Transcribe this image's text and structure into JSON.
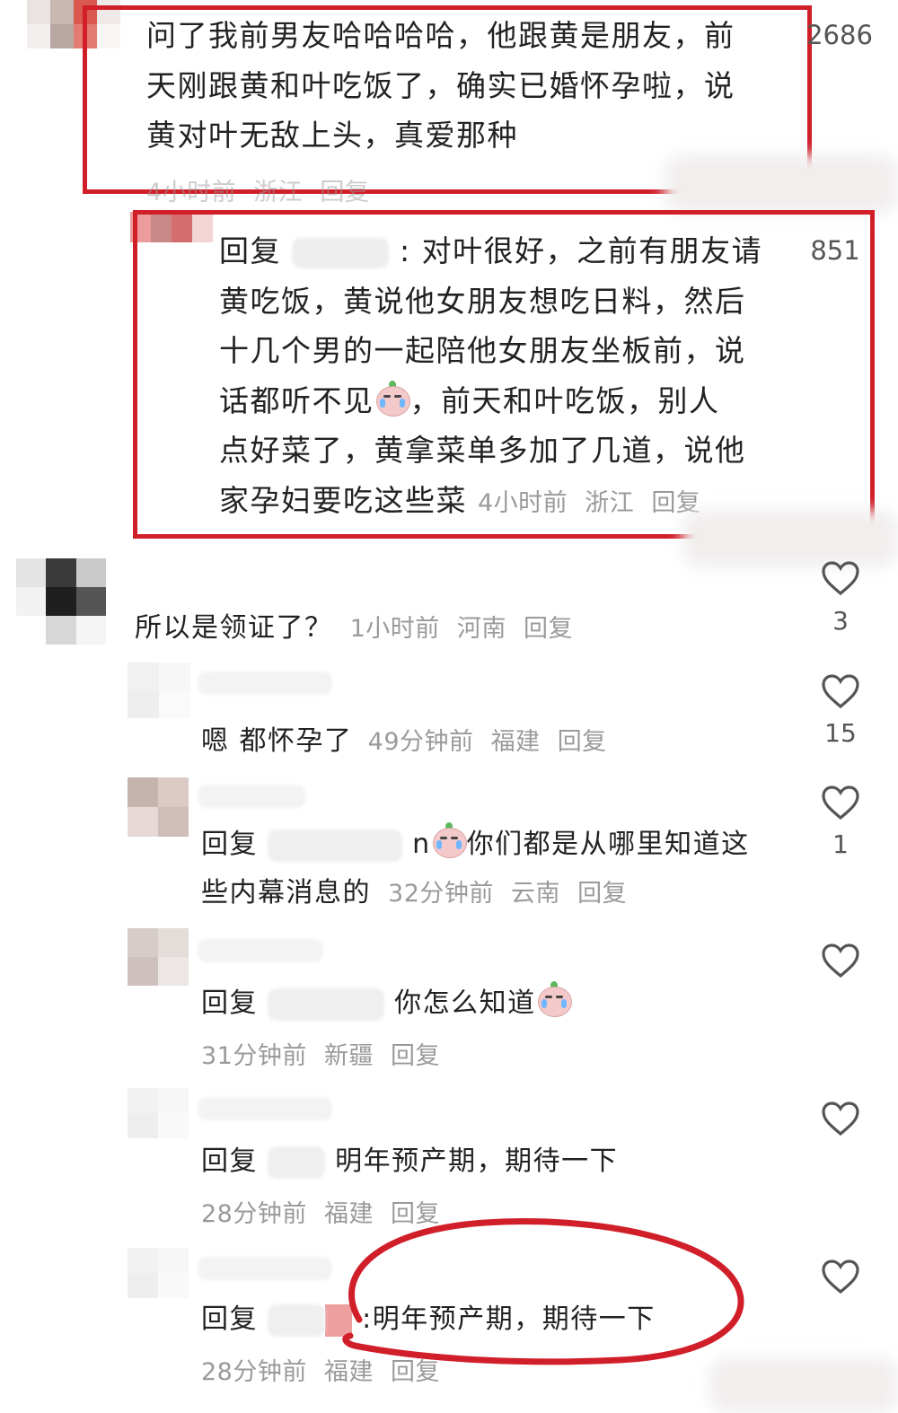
{
  "comments": [
    {
      "id": "c1",
      "text": "问了我前男友哈哈哈哈，他跟黄是朋友，前天刚跟黄和叶吃饭了，确实已婚怀孕啦，说黄对叶无敌上头，真爱那种",
      "lines": [
        "问了我前男友哈哈哈哈，他跟黄是朋友，前",
        "天刚跟黄和叶吃饭了，确实已婚怀孕啦，说",
        "黄对叶无敌上头，真爱那种"
      ],
      "time": "4小时前",
      "location": "浙江",
      "reply_label": "回复",
      "likes": "2686"
    },
    {
      "id": "c2",
      "prefix": "回复",
      "sep": ":",
      "lines": [
        "对叶很好，之前有朋友请",
        "黄吃饭，黄说他女朋友想吃日料，然后",
        "十几个男的一起陪他女朋友坐板前，说",
        "话都听不见",
        "，前天和叶吃饭，别人",
        "点好菜了，黄拿菜单多加了几道，说他",
        "家孕妇要吃这些菜"
      ],
      "time": "4小时前",
      "location": "浙江",
      "reply_label": "回复",
      "likes": "851"
    },
    {
      "id": "c3",
      "text": "所以是领证了？",
      "time": "1小时前",
      "location": "河南",
      "reply_label": "回复",
      "likes": "3"
    },
    {
      "id": "c4",
      "text": "嗯 都怀孕了",
      "time": "49分钟前",
      "location": "福建",
      "reply_label": "回复",
      "likes": "15"
    },
    {
      "id": "c5",
      "prefix": "回复",
      "name_tail": "n",
      "lines": [
        "你们都是从哪里知道这",
        "些内幕消息的"
      ],
      "time": "32分钟前",
      "location": "云南",
      "reply_label": "回复",
      "likes": "1"
    },
    {
      "id": "c6",
      "prefix": "回复",
      "text": "你怎么知道",
      "time": "31分钟前",
      "location": "新疆",
      "reply_label": "回复",
      "likes": ""
    },
    {
      "id": "c7",
      "prefix": "回复",
      "text": "明年预产期，期待一下",
      "time": "28分钟前",
      "location": "福建",
      "reply_label": "回复",
      "likes": ""
    },
    {
      "id": "c8",
      "prefix": "回复",
      "text": ":明年预产期，期待一下",
      "time": "28分钟前",
      "location": "福建",
      "reply_label": "回复",
      "likes": ""
    }
  ],
  "colors": {
    "highlight": "#d11f2a",
    "meta_text": "#9a9a9a",
    "body_text": "#222222"
  },
  "icons": {
    "like": "heart-outline-icon",
    "emoji": "crying-laugh-emoji"
  }
}
